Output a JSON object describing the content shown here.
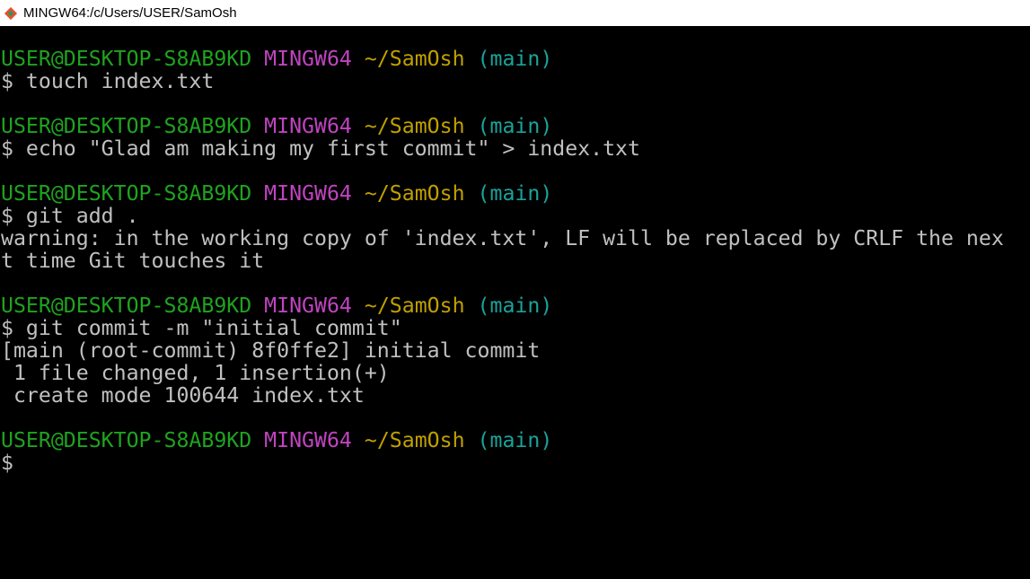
{
  "window": {
    "title": "MINGW64:/c/Users/USER/SamOsh"
  },
  "colors": {
    "user": "#1fa31f",
    "shell": "#bf44bf",
    "path": "#c0a000",
    "branch": "#1aa39a",
    "text": "#c0c0c0",
    "background": "#000000"
  },
  "prompt": {
    "user": "USER@DESKTOP-S8AB9KD",
    "shell": "MINGW64",
    "path": "~/SamOsh",
    "branch": "(main)",
    "symbol": "$"
  },
  "commands": {
    "c1": "$ touch index.txt",
    "c2": "$ echo \"Glad am making my first commit\" > index.txt",
    "c3": "$ git add .",
    "c4": "$ git commit -m \"initial commit\"",
    "c5": "$"
  },
  "output": {
    "warning_1": "warning: in the working copy of 'index.txt', LF will be replaced by CRLF the nex",
    "warning_2": "t time Git touches it",
    "commit_1": "[main (root-commit) 8f0ffe2] initial commit",
    "commit_2": " 1 file changed, 1 insertion(+)",
    "commit_3": " create mode 100644 index.txt"
  }
}
